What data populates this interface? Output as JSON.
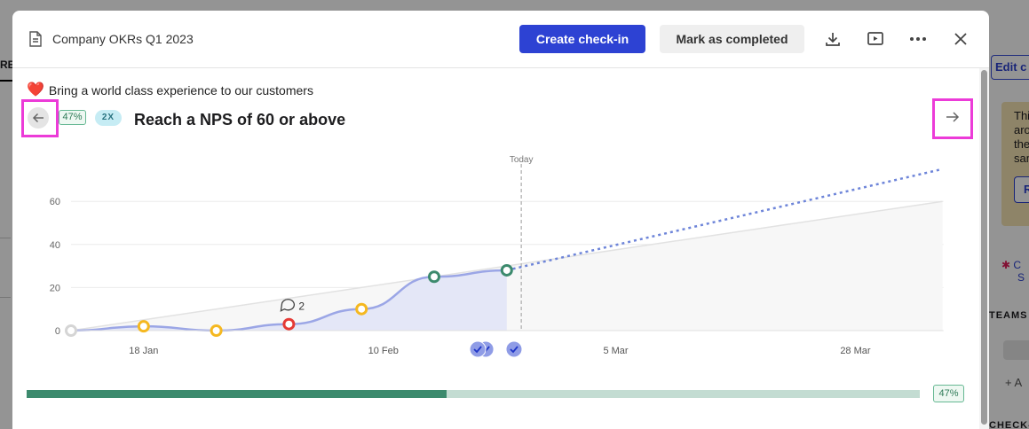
{
  "background": {
    "left_tab": "RE",
    "right_edit_label": "Edit c",
    "right_note_lines": [
      "This",
      "arou",
      "then",
      "samp"
    ],
    "right_note_button": "Re",
    "right_slack_lines": [
      "C",
      "S"
    ],
    "right_teams_label": "TEAMS",
    "right_add_label": "+ A",
    "right_check_label": "CHECK-"
  },
  "header": {
    "doc_title": "Company OKRs Q1 2023",
    "create_checkin_label": "Create check-in",
    "mark_completed_label": "Mark as completed",
    "icons": [
      "download-icon",
      "present-icon",
      "more-icon",
      "close-icon"
    ]
  },
  "objective": {
    "emoji": "❤️",
    "title": "Bring a world class experience to our customers"
  },
  "key_result": {
    "progress_badge": "47%",
    "multiplier_badge": "2X",
    "title": "Reach a NPS of 60 or above"
  },
  "chart_data": {
    "type": "line",
    "today_label": "Today",
    "today_index": 6.2,
    "x_tick_labels": [
      {
        "label": "18 Jan",
        "at": 1
      },
      {
        "label": "10 Feb",
        "at": 4.3
      },
      {
        "label": "5 Mar",
        "at": 7.5
      },
      {
        "label": "28 Mar",
        "at": 10.8
      }
    ],
    "x_range": [
      0,
      12
    ],
    "y_ticks": [
      0,
      20,
      40,
      60
    ],
    "ylim": [
      0,
      60
    ],
    "grid": true,
    "target_line": {
      "from": [
        0,
        0
      ],
      "to": [
        12,
        60
      ]
    },
    "checkins": [
      {
        "x": 0,
        "y": 0,
        "status": "none"
      },
      {
        "x": 1,
        "y": 2,
        "status": "at-risk"
      },
      {
        "x": 2,
        "y": 0,
        "status": "at-risk"
      },
      {
        "x": 3,
        "y": 3,
        "status": "off-track"
      },
      {
        "x": 4,
        "y": 10,
        "status": "at-risk"
      },
      {
        "x": 5,
        "y": 25,
        "status": "on-track"
      },
      {
        "x": 6,
        "y": 28,
        "status": "on-track"
      }
    ],
    "forecast": {
      "from": [
        6,
        28
      ],
      "to": [
        12,
        75
      ]
    },
    "comment": {
      "x": 3,
      "count": "2"
    },
    "task_markers": [
      {
        "x": 5.6,
        "count": 2
      },
      {
        "x": 6.1,
        "count": 1
      }
    ],
    "status_colors": {
      "none": "#d5d5d5",
      "at-risk": "#f5b820",
      "off-track": "#e53a36",
      "on-track": "#3c8a6d"
    },
    "line_color": "#9ba6e6",
    "forecast_color": "#6e85d9",
    "area_color": "#e4e7f7"
  },
  "progress_bar": {
    "value": 0.47,
    "label": "47%"
  }
}
